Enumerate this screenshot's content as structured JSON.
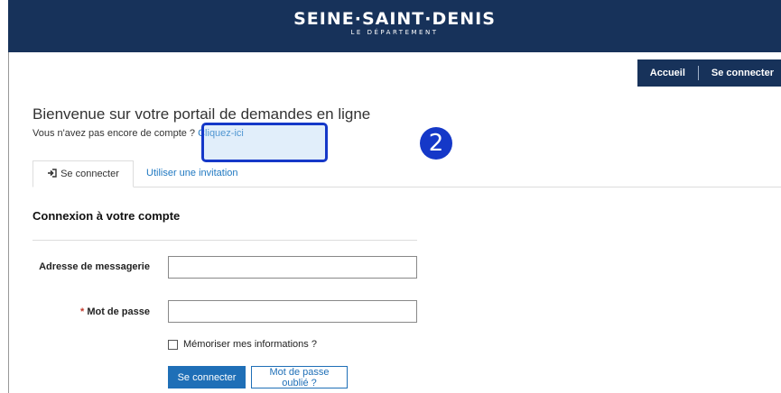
{
  "header": {
    "brand": "SEINE·SAINT·DENIS",
    "brand_subtitle": "LE DÉPARTEMENT",
    "nav_home": "Accueil",
    "nav_login": "Se connecter"
  },
  "intro": {
    "title": "Bienvenue sur votre portail de demandes en ligne",
    "prompt": "Vous n'avez pas encore de compte ? ",
    "signup_link": "Cliquez-ici"
  },
  "annotation": {
    "step_number": "2",
    "highlight_color": "#1538c8"
  },
  "tabs": {
    "login_icon": "sign-in-icon",
    "login_label": "Se connecter",
    "invite_label": "Utiliser une invitation"
  },
  "form": {
    "section_title": "Connexion à votre compte",
    "email_label": "Adresse de messagerie",
    "email_value": "",
    "password_required_mark": "*",
    "password_label": "Mot de passe",
    "password_value": "",
    "remember_label": "Mémoriser mes informations ?",
    "remember_checked": false,
    "submit_label": "Se connecter",
    "forgot_label": "Mot de passe oublié ?"
  },
  "colors": {
    "header_bg": "#17325a",
    "link": "#1f78c1",
    "primary_button": "#1f6fb7"
  }
}
